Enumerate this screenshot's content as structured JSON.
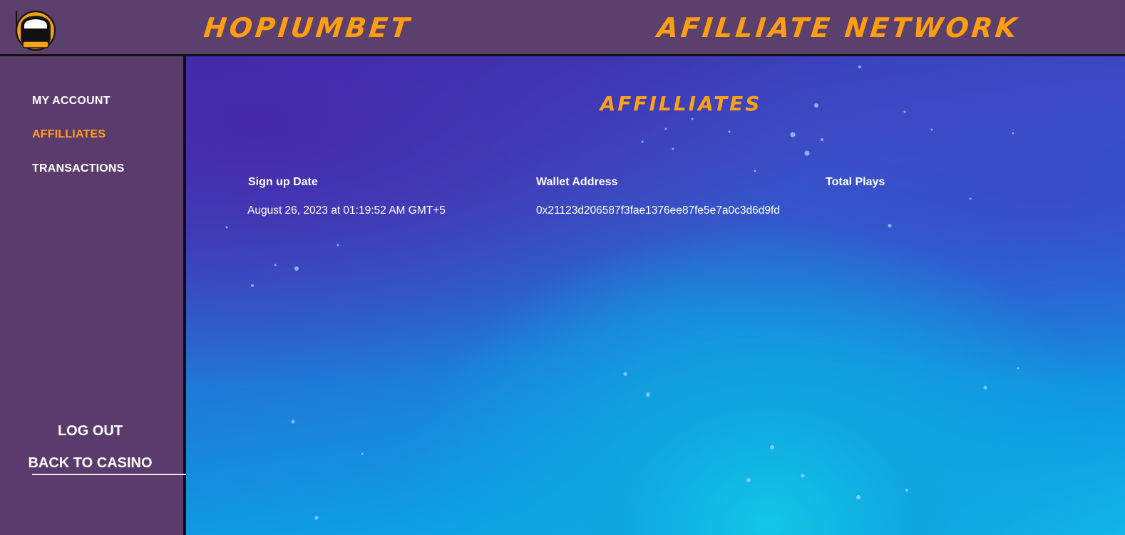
{
  "header": {
    "brand": "HOPIUMBET",
    "network": "AFILLIATE NETWORK",
    "logo_icon": "astronaut-helmet-icon"
  },
  "sidebar": {
    "items": [
      {
        "label": "MY ACCOUNT",
        "active": false
      },
      {
        "label": "AFFILLIATES",
        "active": true
      },
      {
        "label": "TRANSACTIONS",
        "active": false
      }
    ],
    "logout_label": "LOG OUT",
    "back_label": "BACK TO CASINO"
  },
  "main": {
    "title": "AFFILLIATES",
    "table": {
      "columns": [
        "Sign up Date",
        "Wallet Address",
        "Total Plays"
      ],
      "rows": [
        [
          "August 26, 2023 at 01:19:52 AM GMT+5",
          "0x21123d206587f3fae1376ee87fe5e7a0c3d6d9fd",
          ""
        ]
      ]
    }
  },
  "colors": {
    "accent": "#ff9f0f",
    "sidebar_bg": "#5b3b6c",
    "text": "#ffffff"
  }
}
